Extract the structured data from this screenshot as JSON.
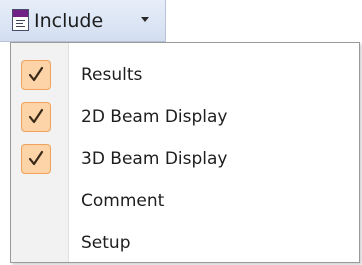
{
  "button": {
    "label": "Include",
    "icon": "report-icon",
    "caret_icon": "chevron-down-icon"
  },
  "menu": {
    "items": [
      {
        "label": "Results",
        "checked": true
      },
      {
        "label": "2D Beam Display",
        "checked": true
      },
      {
        "label": "3D Beam Display",
        "checked": true
      },
      {
        "label": "Comment",
        "checked": false
      },
      {
        "label": "Setup",
        "checked": false
      }
    ]
  },
  "colors": {
    "check_fill": "#fdd3a8",
    "check_border": "#f0a25a",
    "icon_accent": "#6f1f86"
  }
}
